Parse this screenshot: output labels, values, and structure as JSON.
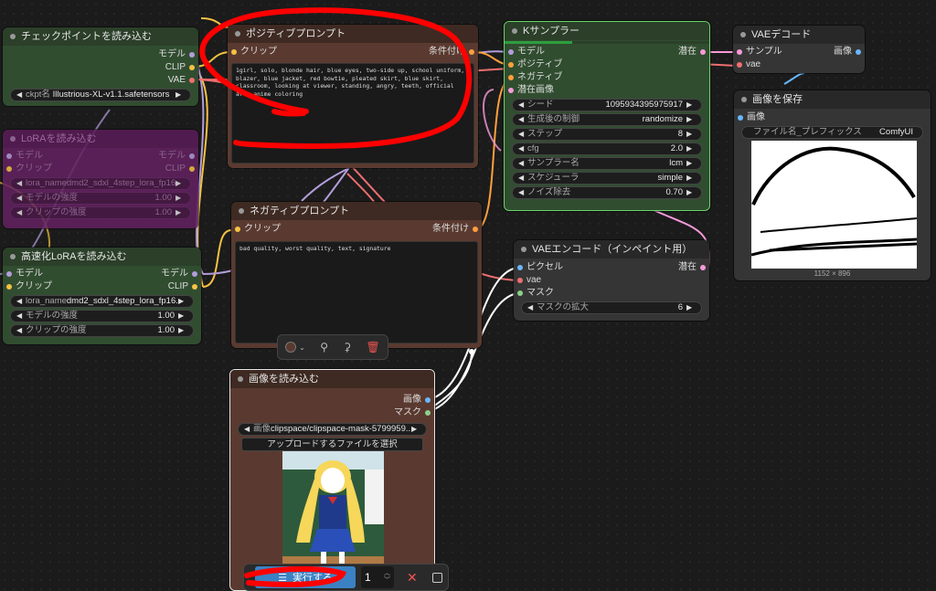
{
  "nodes": {
    "checkpoint": {
      "title": "チェックポイントを読み込む",
      "outputs": [
        "モデル",
        "CLIP",
        "VAE"
      ],
      "widget_label": "ckpt名",
      "widget_value": "Illustrious-XL-v1.1.safetensors"
    },
    "lora_bypassed": {
      "title": "LoRAを読み込む",
      "inputs": [
        "モデル",
        "クリップ"
      ],
      "outputs": [
        "モデル",
        "CLIP"
      ],
      "widgets": [
        {
          "label": "lora_name",
          "value": "dmd2_sdxl_4step_lora_fp16"
        },
        {
          "label": "モデルの強度",
          "value": "1.00"
        },
        {
          "label": "クリップの強度",
          "value": "1.00"
        }
      ]
    },
    "fast_lora": {
      "title": "高速化LoRAを読み込む",
      "inputs": [
        "モデル",
        "クリップ"
      ],
      "outputs": [
        "モデル",
        "CLIP"
      ],
      "widgets": [
        {
          "label": "lora_name",
          "value": "dmd2_sdxl_4step_lora_fp16...."
        },
        {
          "label": "モデルの強度",
          "value": "1.00"
        },
        {
          "label": "クリップの強度",
          "value": "1.00"
        }
      ]
    },
    "positive": {
      "title": "ポジティブプロンプト",
      "input": "クリップ",
      "output": "条件付け",
      "text": "1girl, solo, blonde hair, blue eyes, two-side up, school uniform, blazer, blue jacket, red bowtie, pleated skirt, blue skirt, classroom, looking at viewer, standing, angry, teeth, official art, anime coloring"
    },
    "negative": {
      "title": "ネガティブプロンプト",
      "input": "クリップ",
      "output": "条件付け",
      "text": "bad quality, worst quality, text, signature"
    },
    "ksampler": {
      "title": "Kサンプラー",
      "inputs": [
        "モデル",
        "ポジティブ",
        "ネガティブ",
        "潜在画像"
      ],
      "output": "潜在",
      "progress": 0.33,
      "widgets": [
        {
          "label": "シード",
          "value": "1095934395975917"
        },
        {
          "label": "生成後の制御",
          "value": "randomize"
        },
        {
          "label": "ステップ",
          "value": "8"
        },
        {
          "label": "cfg",
          "value": "2.0"
        },
        {
          "label": "サンプラー名",
          "value": "lcm"
        },
        {
          "label": "スケジューラ",
          "value": "simple"
        },
        {
          "label": "ノイズ除去",
          "value": "0.70"
        }
      ]
    },
    "vae_decode": {
      "title": "VAEデコード",
      "inputs": [
        "サンプル",
        "vae"
      ],
      "output": "画像"
    },
    "save_image": {
      "title": "画像を保存",
      "input": "画像",
      "widget_label": "ファイル名_プレフィックス",
      "widget_value": "ComfyUI",
      "dimensions": "1152 × 896"
    },
    "vae_encode": {
      "title": "VAEエンコード（インペイント用）",
      "inputs": [
        "ピクセル",
        "vae",
        "マスク"
      ],
      "output": "潜在",
      "widget_label": "マスクの拡大",
      "widget_value": "6"
    },
    "load_image": {
      "title": "画像を読み込む",
      "outputs": [
        "画像",
        "マスク"
      ],
      "widget_label": "画像",
      "widget_value": "clipspace/clipspace-mask-5799959....",
      "upload_label": "アップロードするファイルを選択"
    }
  },
  "run_bar": {
    "run_label": "実行する",
    "count": "1"
  },
  "colors": {
    "annotation": "#ff0000",
    "clip_wire": "#f5c242",
    "model_wire": "#b39ddb",
    "vae_wire": "#ef6f6f",
    "latent_wire": "#f59ad8",
    "image_wire": "#6ab7ff"
  }
}
